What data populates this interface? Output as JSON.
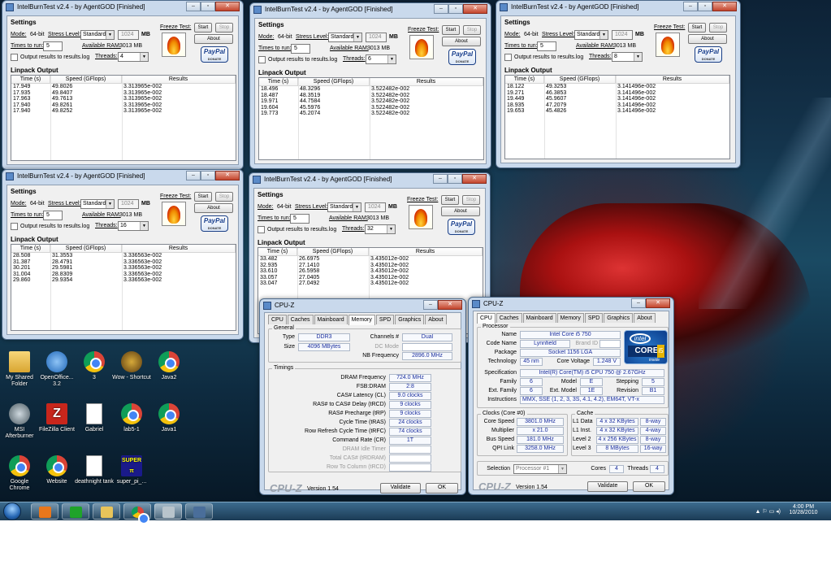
{
  "intelburn": {
    "settings_header": "Settings",
    "mode_label": "Mode:",
    "mode_value": "64-bit",
    "stress_label": "Stress Level:",
    "stress_value": "Standard",
    "mem_value": "1024",
    "mem_unit": "MB",
    "times_label": "Times to run:",
    "times_value": "5",
    "ram_label": "Available RAM:",
    "ram_value": "3013 MB",
    "output_label": "Output results to results.log",
    "threads_label": "Threads:",
    "freeze_label": "Freeze Test:",
    "start": "Start",
    "stop": "Stop",
    "about": "About",
    "paypal": "PayPal",
    "donate": "DONATE",
    "linpack_header": "Linpack Output",
    "col_time": "Time (s)",
    "col_speed": "Speed (GFlops)",
    "col_results": "Results"
  },
  "ib_windows": [
    {
      "title": "IntelBurnTest v2.4 - by AgentGOD [Finished]",
      "threads": "4",
      "rows": [
        [
          "17.949",
          "49.8026",
          "3.313965e-002"
        ],
        [
          "17.935",
          "49.8407",
          "3.313965e-002"
        ],
        [
          "17.963",
          "49.7613",
          "3.313965e-002"
        ],
        [
          "17.940",
          "49.8261",
          "3.313965e-002"
        ],
        [
          "17.940",
          "49.8252",
          "3.313965e-002"
        ]
      ]
    },
    {
      "title": "IntelBurnTest v2.4 - by AgentGOD [Finished]",
      "threads": "6",
      "rows": [
        [
          "18.496",
          "48.3296",
          "3.522482e-002"
        ],
        [
          "18.487",
          "48.3519",
          "3.522482e-002"
        ],
        [
          "19.971",
          "44.7584",
          "3.522482e-002"
        ],
        [
          "19.604",
          "45.5976",
          "3.522482e-002"
        ],
        [
          "19.773",
          "45.2074",
          "3.522482e-002"
        ]
      ]
    },
    {
      "title": "IntelBurnTest v2.4 - by AgentGOD [Finished]",
      "threads": "8",
      "rows": [
        [
          "18.122",
          "49.3253",
          "3.141496e-002"
        ],
        [
          "19.271",
          "46.3853",
          "3.141496e-002"
        ],
        [
          "19.449",
          "45.9607",
          "3.141496e-002"
        ],
        [
          "18.935",
          "47.2079",
          "3.141496e-002"
        ],
        [
          "19.653",
          "45.4826",
          "3.141496e-002"
        ]
      ]
    },
    {
      "title": "IntelBurnTest v2.4 - by AgentGOD [Finished]",
      "threads": "16",
      "rows": [
        [
          "28.508",
          "31.3553",
          "3.336563e-002"
        ],
        [
          "31.387",
          "28.4791",
          "3.336563e-002"
        ],
        [
          "30.201",
          "29.5981",
          "3.336563e-002"
        ],
        [
          "31.004",
          "28.8309",
          "3.336563e-002"
        ],
        [
          "29.860",
          "29.9354",
          "3.336563e-002"
        ]
      ]
    },
    {
      "title": "IntelBurnTest v2.4 - by AgentGOD [Finished]",
      "threads": "32",
      "rows": [
        [
          "33.482",
          "26.6975",
          "3.435012e-002"
        ],
        [
          "32.935",
          "27.1410",
          "3.435012e-002"
        ],
        [
          "33.610",
          "26.5958",
          "3.435012e-002"
        ],
        [
          "33.057",
          "27.0405",
          "3.435012e-002"
        ],
        [
          "33.047",
          "27.0492",
          "3.435012e-002"
        ]
      ]
    }
  ],
  "cpuz_common": {
    "title": "CPU-Z",
    "tabs": [
      "CPU",
      "Caches",
      "Mainboard",
      "Memory",
      "SPD",
      "Graphics",
      "About"
    ],
    "logo": "CPU-Z",
    "version": "Version 1.54",
    "validate": "Validate",
    "ok": "OK"
  },
  "cpuz_mem": {
    "general": "General",
    "type_k": "Type",
    "type_v": "DDR3",
    "size_k": "Size",
    "size_v": "4096 MBytes",
    "channels_k": "Channels #",
    "channels_v": "Dual",
    "dcmode_k": "DC Mode",
    "nbfreq_k": "NB Frequency",
    "nbfreq_v": "2896.0 MHz",
    "timings": "Timings",
    "rows": [
      {
        "k": "DRAM Frequency",
        "v": "724.0 MHz"
      },
      {
        "k": "FSB:DRAM",
        "v": "2:8"
      },
      {
        "k": "CAS# Latency (CL)",
        "v": "9.0 clocks"
      },
      {
        "k": "RAS# to CAS# Delay (tRCD)",
        "v": "9 clocks"
      },
      {
        "k": "RAS# Precharge (tRP)",
        "v": "9 clocks"
      },
      {
        "k": "Cycle Time (tRAS)",
        "v": "24 clocks"
      },
      {
        "k": "Row Refresh Cycle Time (tRFC)",
        "v": "74 clocks"
      },
      {
        "k": "Command Rate (CR)",
        "v": "1T"
      }
    ],
    "disabled": [
      "DRAM Idle Timer",
      "Total CAS# (tRDRAM)",
      "Row To Column (tRCD)"
    ]
  },
  "cpuz_cpu": {
    "processor": "Processor",
    "name_k": "Name",
    "name_v": "Intel Core i5 750",
    "code_k": "Code Name",
    "code_v": "Lynnfield",
    "brand_k": "Brand ID",
    "pkg_k": "Package",
    "pkg_v": "Socket 1156 LGA",
    "tech_k": "Technology",
    "tech_v": "45 nm",
    "volt_k": "Core Voltage",
    "volt_v": "1.248 V",
    "spec_k": "Specification",
    "spec_v": "Intel(R) Core(TM) i5 CPU        750  @ 2.67GHz",
    "fam_k": "Family",
    "fam_v": "6",
    "model_k": "Model",
    "model_v": "E",
    "step_k": "Stepping",
    "step_v": "5",
    "efam_k": "Ext. Family",
    "efam_v": "6",
    "emodel_k": "Ext. Model",
    "emodel_v": "1E",
    "rev_k": "Revision",
    "rev_v": "B1",
    "instr_k": "Instructions",
    "instr_v": "MMX, SSE (1, 2, 3, 3S, 4.1, 4.2), EM64T, VT-x",
    "clocks": "Clocks (Core #0)",
    "cspeed_k": "Core Speed",
    "cspeed_v": "3801.0 MHz",
    "mult_k": "Multiplier",
    "mult_v": "x 21.0",
    "bus_k": "Bus Speed",
    "bus_v": "181.0 MHz",
    "qpi_k": "QPI Link",
    "qpi_v": "3258.0 MHz",
    "cache": "Cache",
    "l1d_k": "L1 Data",
    "l1d_v": "4 x 32 KBytes",
    "l1d_w": "8-way",
    "l1i_k": "L1 Inst.",
    "l1i_v": "4 x 32 KBytes",
    "l1i_w": "4-way",
    "l2_k": "Level 2",
    "l2_v": "4 x 256 KBytes",
    "l2_w": "8-way",
    "l3_k": "Level 3",
    "l3_v": "8 MBytes",
    "l3_w": "16-way",
    "sel_k": "Selection",
    "sel_v": "Processor #1",
    "cores_k": "Cores",
    "cores_v": "4",
    "threads_k": "Threads",
    "threads_v": "4",
    "badge_intel": "intel",
    "badge_core": "CORE",
    "badge_i": "i5",
    "badge_inside": "inside"
  },
  "desktop_icons": [
    {
      "label": "My Shared Folder",
      "icon": "folder"
    },
    {
      "label": "OpenOffice... 3.2",
      "icon": "openoffice"
    },
    {
      "label": "3",
      "icon": "chrome"
    },
    {
      "label": "Wow - Shortcut",
      "icon": "wow"
    },
    {
      "label": "Java2",
      "icon": "chrome"
    },
    {
      "label": "MSI Afterburner",
      "icon": "msi"
    },
    {
      "label": "FileZilla Client",
      "icon": "filezilla"
    },
    {
      "label": "Gabriel",
      "icon": "document"
    },
    {
      "label": "lab5-1",
      "icon": "chrome"
    },
    {
      "label": "Java1",
      "icon": "chrome"
    },
    {
      "label": "Google Chrome",
      "icon": "chrome"
    },
    {
      "label": "Website",
      "icon": "chrome"
    },
    {
      "label": "deathnight tank",
      "icon": "document"
    },
    {
      "label": "super_pi_...",
      "icon": "superpi"
    }
  ],
  "tray": {
    "time": "4:00 PM",
    "date": "10/28/2010"
  }
}
